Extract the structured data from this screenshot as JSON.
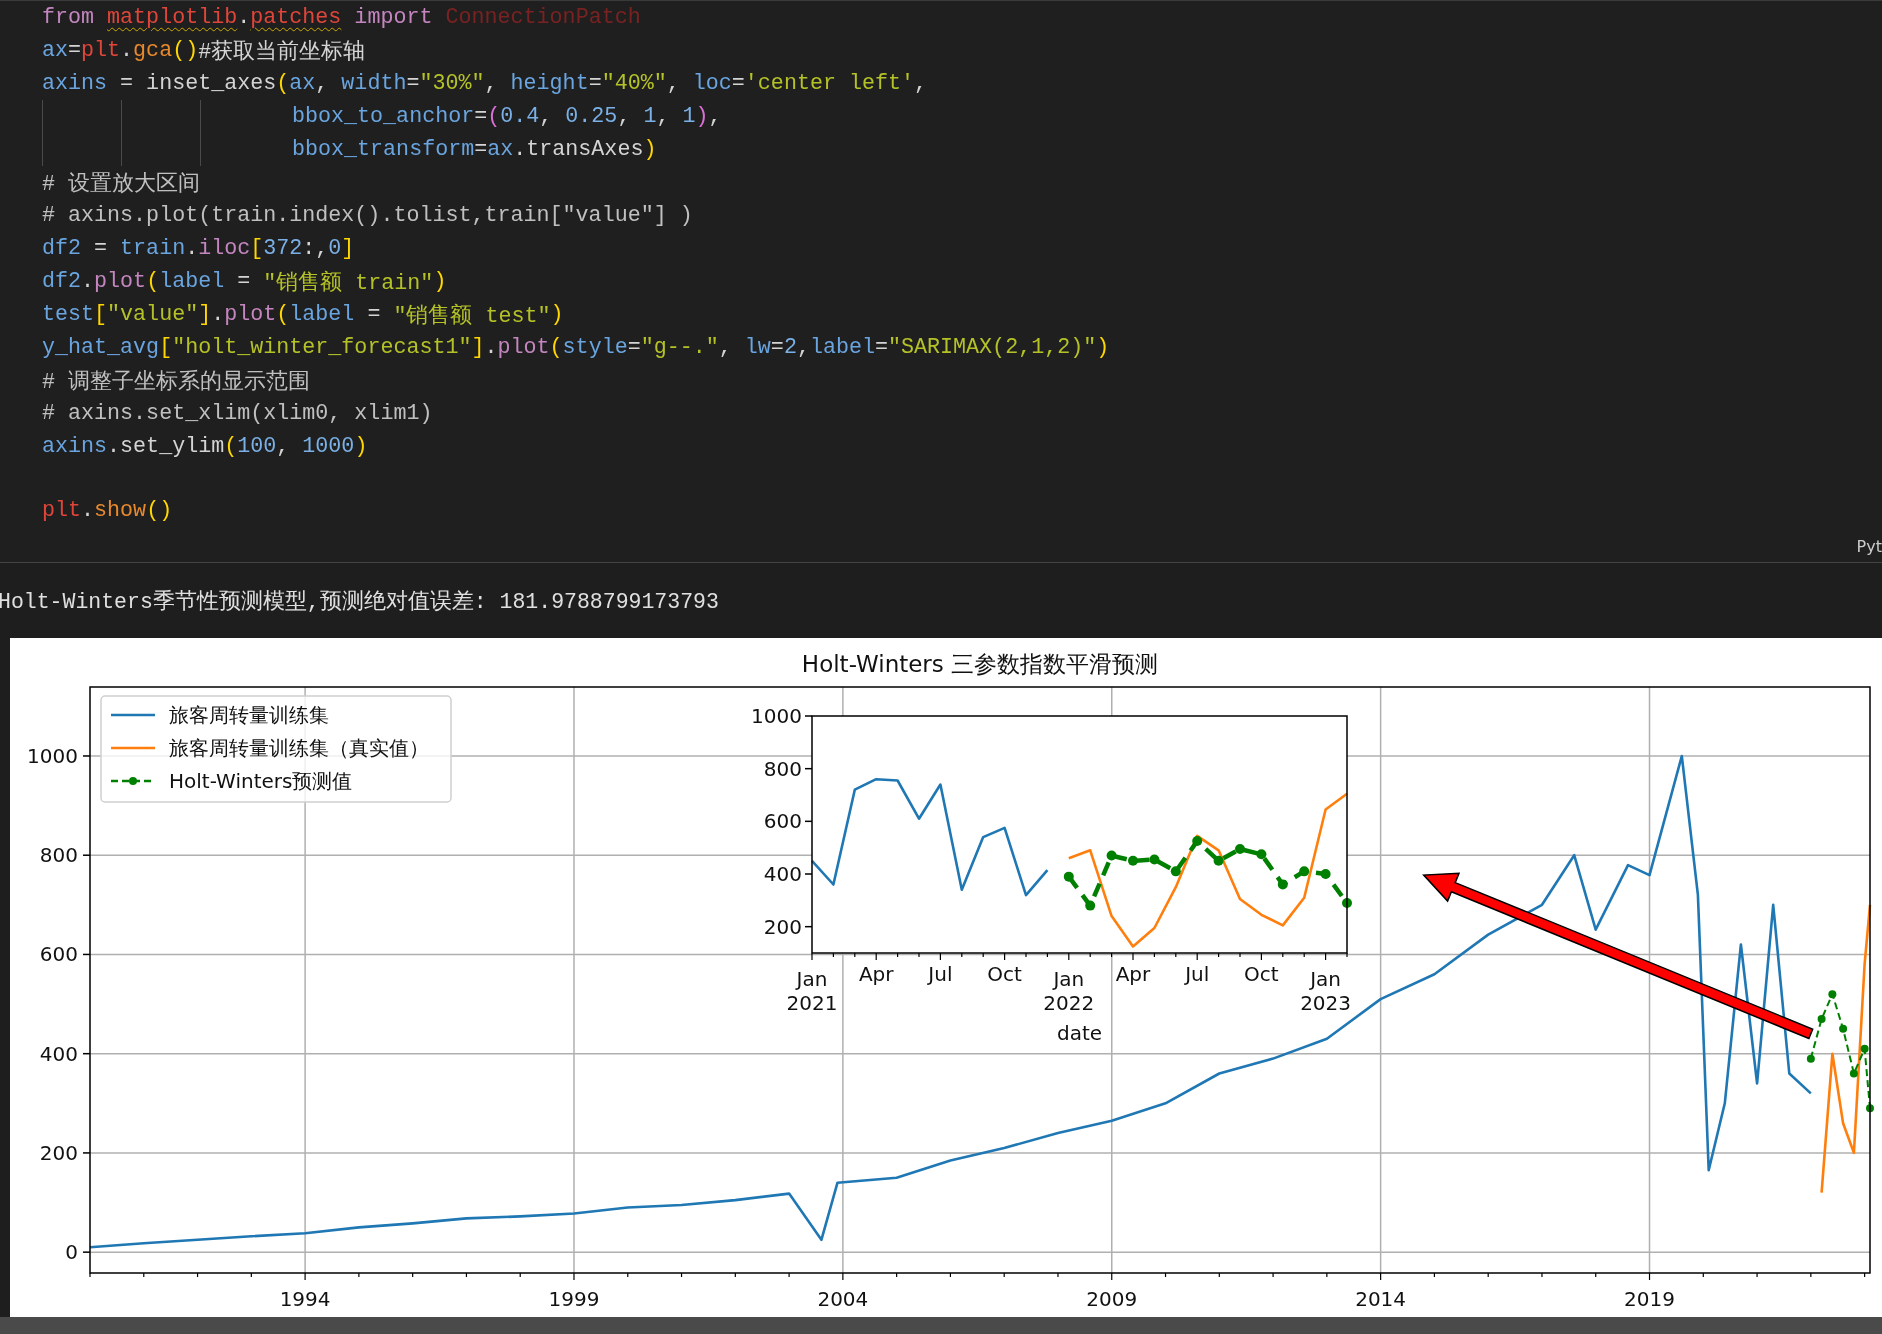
{
  "editor": {
    "language_label": "Pyt",
    "lines": [
      {
        "tokens": [
          {
            "kind": "kw",
            "text": "from "
          },
          {
            "kind": "mod",
            "text": "matplotlib"
          },
          {
            "kind": "txt",
            "text": "."
          },
          {
            "kind": "mod",
            "text": "patches"
          },
          {
            "kind": "kw",
            "text": " import "
          },
          {
            "kind": "dim",
            "text": "ConnectionPatch"
          }
        ]
      },
      {
        "tokens": [
          {
            "kind": "var",
            "text": "ax"
          },
          {
            "kind": "txt",
            "text": "="
          },
          {
            "kind": "obj",
            "text": "plt"
          },
          {
            "kind": "txt",
            "text": "."
          },
          {
            "kind": "fn",
            "text": "gca"
          },
          {
            "kind": "p1",
            "text": "()"
          },
          {
            "kind": "txt",
            "text": "#获取当前坐标轴"
          }
        ]
      },
      {
        "tokens": [
          {
            "kind": "var",
            "text": "axins"
          },
          {
            "kind": "txt",
            "text": " = inset_axes"
          },
          {
            "kind": "p1",
            "text": "("
          },
          {
            "kind": "var",
            "text": "ax"
          },
          {
            "kind": "txt",
            "text": ", "
          },
          {
            "kind": "var",
            "text": "width"
          },
          {
            "kind": "txt",
            "text": "="
          },
          {
            "kind": "str",
            "text": "\"30%\""
          },
          {
            "kind": "txt",
            "text": ", "
          },
          {
            "kind": "var",
            "text": "height"
          },
          {
            "kind": "txt",
            "text": "="
          },
          {
            "kind": "str",
            "text": "\"40%\""
          },
          {
            "kind": "txt",
            "text": ", "
          },
          {
            "kind": "var",
            "text": "loc"
          },
          {
            "kind": "txt",
            "text": "="
          },
          {
            "kind": "str",
            "text": "'center left'"
          },
          {
            "kind": "txt",
            "text": ","
          }
        ]
      },
      {
        "continuation": true,
        "tokens": [
          {
            "kind": "var",
            "text": "bbox_to_anchor"
          },
          {
            "kind": "txt",
            "text": "="
          },
          {
            "kind": "p2",
            "text": "("
          },
          {
            "kind": "num",
            "text": "0.4"
          },
          {
            "kind": "txt",
            "text": ", "
          },
          {
            "kind": "num",
            "text": "0.25"
          },
          {
            "kind": "txt",
            "text": ", "
          },
          {
            "kind": "num",
            "text": "1"
          },
          {
            "kind": "txt",
            "text": ", "
          },
          {
            "kind": "num",
            "text": "1"
          },
          {
            "kind": "p2",
            "text": ")"
          },
          {
            "kind": "txt",
            "text": ","
          }
        ]
      },
      {
        "continuation": true,
        "tokens": [
          {
            "kind": "var",
            "text": "bbox_transform"
          },
          {
            "kind": "txt",
            "text": "="
          },
          {
            "kind": "var",
            "text": "ax"
          },
          {
            "kind": "txt",
            "text": ".transAxes"
          },
          {
            "kind": "p1",
            "text": ")"
          }
        ]
      },
      {
        "tokens": [
          {
            "kind": "cmt",
            "text": "# 设置放大区间"
          }
        ]
      },
      {
        "tokens": [
          {
            "kind": "cmt",
            "text": "# axins.plot(train.index().tolist,train[\"value\"] )"
          }
        ]
      },
      {
        "tokens": [
          {
            "kind": "var",
            "text": "df2"
          },
          {
            "kind": "txt",
            "text": " = "
          },
          {
            "kind": "var",
            "text": "train"
          },
          {
            "kind": "txt",
            "text": "."
          },
          {
            "kind": "meth",
            "text": "iloc"
          },
          {
            "kind": "p1",
            "text": "["
          },
          {
            "kind": "num",
            "text": "372"
          },
          {
            "kind": "txt",
            "text": ":,"
          },
          {
            "kind": "num",
            "text": "0"
          },
          {
            "kind": "p1",
            "text": "]"
          }
        ]
      },
      {
        "tokens": [
          {
            "kind": "var",
            "text": "df2"
          },
          {
            "kind": "txt",
            "text": "."
          },
          {
            "kind": "meth",
            "text": "plot"
          },
          {
            "kind": "p1",
            "text": "("
          },
          {
            "kind": "var",
            "text": "label"
          },
          {
            "kind": "txt",
            "text": " = "
          },
          {
            "kind": "str",
            "text": "\"销售额 train\""
          },
          {
            "kind": "p1",
            "text": ")"
          }
        ]
      },
      {
        "tokens": [
          {
            "kind": "var",
            "text": "test"
          },
          {
            "kind": "p1",
            "text": "["
          },
          {
            "kind": "str",
            "text": "\"value\""
          },
          {
            "kind": "p1",
            "text": "]"
          },
          {
            "kind": "txt",
            "text": "."
          },
          {
            "kind": "meth",
            "text": "plot"
          },
          {
            "kind": "p1",
            "text": "("
          },
          {
            "kind": "var",
            "text": "label"
          },
          {
            "kind": "txt",
            "text": " = "
          },
          {
            "kind": "str",
            "text": "\"销售额 test\""
          },
          {
            "kind": "p1",
            "text": ")"
          }
        ]
      },
      {
        "tokens": [
          {
            "kind": "var",
            "text": "y_hat_avg"
          },
          {
            "kind": "p1",
            "text": "["
          },
          {
            "kind": "str",
            "text": "\"holt_winter_forecast1\""
          },
          {
            "kind": "p1",
            "text": "]"
          },
          {
            "kind": "txt",
            "text": "."
          },
          {
            "kind": "meth",
            "text": "plot"
          },
          {
            "kind": "p1",
            "text": "("
          },
          {
            "kind": "var",
            "text": "style"
          },
          {
            "kind": "txt",
            "text": "="
          },
          {
            "kind": "str",
            "text": "\"g--.\""
          },
          {
            "kind": "txt",
            "text": ", "
          },
          {
            "kind": "var",
            "text": "lw"
          },
          {
            "kind": "txt",
            "text": "="
          },
          {
            "kind": "num",
            "text": "2"
          },
          {
            "kind": "txt",
            "text": ","
          },
          {
            "kind": "var",
            "text": "label"
          },
          {
            "kind": "txt",
            "text": "="
          },
          {
            "kind": "str",
            "text": "\"SARIMAX(2,1,2)\""
          },
          {
            "kind": "p1",
            "text": ")"
          }
        ]
      },
      {
        "tokens": [
          {
            "kind": "cmt",
            "text": "# 调整子坐标系的显示范围"
          }
        ]
      },
      {
        "tokens": [
          {
            "kind": "cmt",
            "text": "# axins.set_xlim(xlim0, xlim1)"
          }
        ]
      },
      {
        "tokens": [
          {
            "kind": "var",
            "text": "axins"
          },
          {
            "kind": "txt",
            "text": ".set_ylim"
          },
          {
            "kind": "p1",
            "text": "("
          },
          {
            "kind": "num",
            "text": "100"
          },
          {
            "kind": "txt",
            "text": ", "
          },
          {
            "kind": "num",
            "text": "1000"
          },
          {
            "kind": "p1",
            "text": ")"
          }
        ]
      },
      {
        "blank_before": true,
        "tokens": [
          {
            "kind": "obj",
            "text": "plt"
          },
          {
            "kind": "txt",
            "text": "."
          },
          {
            "kind": "fn",
            "text": "show"
          },
          {
            "kind": "p1",
            "text": "()"
          }
        ]
      }
    ]
  },
  "output": {
    "text": "Holt-Winters季节性预测模型,预测绝对值误差: 181.9788799173793"
  },
  "figure": {
    "chart_data": {
      "type": "line",
      "title": "Holt-Winters 三参数指数平滑预测",
      "grid": true,
      "legend": "upper left",
      "x": [
        1990,
        1991,
        1992,
        1993,
        1994,
        1995,
        1996,
        1997,
        1998,
        1999,
        2000,
        2001,
        2002,
        2003,
        2003.6,
        2003.9,
        2005,
        2006,
        2007,
        2008,
        2009,
        2010,
        2011,
        2012,
        2013,
        2014,
        2015,
        2016,
        2017,
        2017.6,
        2018,
        2018.6,
        2019,
        2019.6,
        2019.9,
        2020.1,
        2020.4,
        2020.7,
        2021.0,
        2021.3,
        2021.6,
        2022.0,
        2022.2,
        2022.4,
        2022.6,
        2022.8,
        2023.0,
        2023.1
      ],
      "series": [
        {
          "name": "旅客周转量训练集",
          "color": "#1f77b4",
          "line_style": "solid",
          "values": [
            10,
            18,
            25,
            32,
            38,
            50,
            58,
            68,
            72,
            78,
            90,
            95,
            105,
            118,
            25,
            140,
            150,
            185,
            210,
            240,
            265,
            300,
            360,
            390,
            430,
            510,
            560,
            640,
            700,
            800,
            650,
            780,
            760,
            1000,
            720,
            165,
            300,
            620,
            340,
            700,
            360,
            320,
            null,
            null,
            null,
            null,
            null,
            null
          ]
        },
        {
          "name": "旅客周转量训练集（真实值）",
          "color": "#ff7f0e",
          "line_style": "solid",
          "values": [
            null,
            null,
            null,
            null,
            null,
            null,
            null,
            null,
            null,
            null,
            null,
            null,
            null,
            null,
            null,
            null,
            null,
            null,
            null,
            null,
            null,
            null,
            null,
            null,
            null,
            null,
            null,
            null,
            null,
            null,
            null,
            null,
            null,
            null,
            null,
            null,
            null,
            null,
            null,
            null,
            null,
            null,
            120,
            400,
            260,
            200,
            580,
            700
          ]
        },
        {
          "name": "Holt-Winters预测值",
          "color": "#008000",
          "line_style": "dashed",
          "marker": "o",
          "values": [
            null,
            null,
            null,
            null,
            null,
            null,
            null,
            null,
            null,
            null,
            null,
            null,
            null,
            null,
            null,
            null,
            null,
            null,
            null,
            null,
            null,
            null,
            null,
            null,
            null,
            null,
            null,
            null,
            null,
            null,
            null,
            null,
            null,
            null,
            null,
            null,
            null,
            null,
            null,
            null,
            null,
            390,
            470,
            520,
            450,
            360,
            410,
            290
          ]
        }
      ],
      "xlim": [
        1990,
        2023.1
      ],
      "ylim": [
        -42,
        1139
      ],
      "xticks": [
        1994,
        1999,
        2004,
        2009,
        2014,
        2019
      ],
      "yticks": [
        0,
        200,
        400,
        600,
        800,
        1000
      ]
    },
    "inset": {
      "chart_data": {
        "type": "line",
        "xlabel": "date",
        "grid": false,
        "categories": [
          "Jan 2021",
          null,
          null,
          "Apr",
          null,
          null,
          "Jul",
          null,
          null,
          "Oct",
          null,
          null,
          "Jan 2022",
          null,
          null,
          "Apr",
          null,
          null,
          "Jul",
          null,
          null,
          "Oct",
          null,
          null,
          "Jan 2023",
          null
        ],
        "series": [
          {
            "color": "#1f77b4",
            "line_style": "solid",
            "values": [
              450,
              360,
              720,
              760,
              755,
              610,
              740,
              340,
              540,
              575,
              320,
              415,
              null,
              null,
              null,
              null,
              null,
              null,
              null,
              null,
              null,
              null,
              null,
              null,
              null,
              null
            ]
          },
          {
            "color": "#ff7f0e",
            "line_style": "solid",
            "values": [
              null,
              null,
              null,
              null,
              null,
              null,
              null,
              null,
              null,
              null,
              null,
              null,
              460,
              490,
              240,
              125,
              195,
              350,
              545,
              490,
              305,
              245,
              205,
              310,
              645,
              705
            ]
          },
          {
            "color": "#008000",
            "line_style": "dashed",
            "marker": "o",
            "values": [
              null,
              null,
              null,
              null,
              null,
              null,
              null,
              null,
              null,
              null,
              null,
              null,
              390,
              280,
              470,
              450,
              455,
              410,
              525,
              450,
              495,
              475,
              360,
              410,
              400,
              290
            ]
          }
        ],
        "ylim": [
          100,
          1000
        ],
        "yticks": [
          200,
          400,
          600,
          800,
          1000
        ]
      }
    }
  }
}
